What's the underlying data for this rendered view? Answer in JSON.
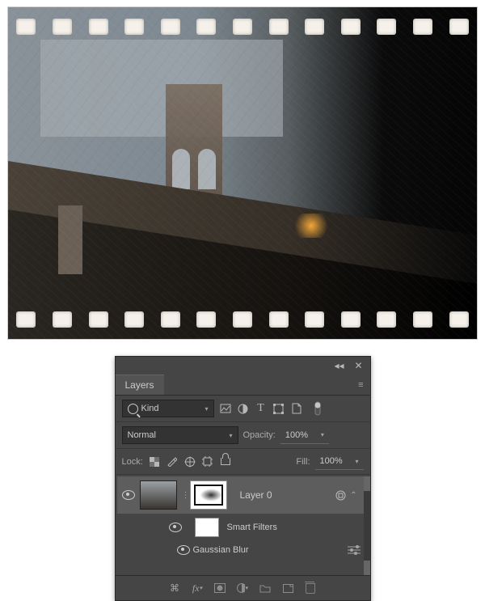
{
  "panel": {
    "tab": "Layers",
    "filter": {
      "label": "Kind"
    },
    "blend": {
      "mode": "Normal",
      "opacityLabel": "Opacity:",
      "opacityValue": "100%"
    },
    "lock": {
      "label": "Lock:",
      "fillLabel": "Fill:",
      "fillValue": "100%"
    },
    "layers": [
      {
        "name": "Layer 0",
        "smartFiltersLabel": "Smart Filters",
        "filters": [
          "Gaussian Blur"
        ]
      }
    ]
  }
}
